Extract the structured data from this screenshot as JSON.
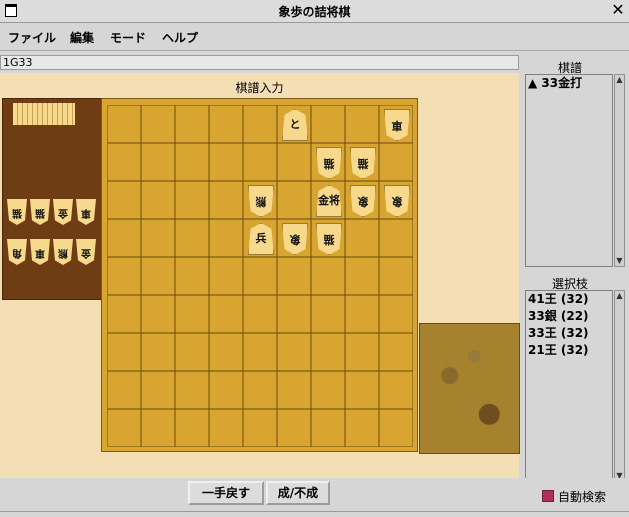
{
  "window": {
    "title": "象歩の詰将棋",
    "close": "✕"
  },
  "menu": {
    "file": "ファイル",
    "edit": "編集",
    "mode": "モード",
    "help": "ヘルプ"
  },
  "status_text": "1G33",
  "board": {
    "label": "棋譜入力",
    "pieces": [
      {
        "col": 5,
        "row": 0,
        "char": "と",
        "side": "sente"
      },
      {
        "col": 8,
        "row": 0,
        "char": "車",
        "side": "gote"
      },
      {
        "col": 6,
        "row": 1,
        "char": "猫",
        "side": "gote"
      },
      {
        "col": 7,
        "row": 1,
        "char": "猫",
        "side": "gote"
      },
      {
        "col": 4,
        "row": 2,
        "char": "熊",
        "side": "gote"
      },
      {
        "col": 6,
        "row": 2,
        "char": "金将",
        "side": "sente"
      },
      {
        "col": 7,
        "row": 2,
        "char": "象",
        "side": "gote"
      },
      {
        "col": 8,
        "row": 2,
        "char": "象",
        "side": "gote"
      },
      {
        "col": 4,
        "row": 3,
        "char": "兵",
        "side": "sente"
      },
      {
        "col": 5,
        "row": 3,
        "char": "象",
        "side": "gote"
      },
      {
        "col": 6,
        "row": 3,
        "char": "猫",
        "side": "gote"
      }
    ]
  },
  "hand_pieces": [
    {
      "char": "角"
    },
    {
      "char": "車"
    },
    {
      "char": "熊"
    },
    {
      "char": "金"
    },
    {
      "char": "猫"
    },
    {
      "char": "猫"
    },
    {
      "char": "金"
    },
    {
      "char": "車"
    }
  ],
  "kifu": {
    "title": "棋譜",
    "moves": [
      "▲ 33金打"
    ]
  },
  "candidates": {
    "title": "選択枝",
    "items": [
      "41王 (32)",
      "33銀 (22)",
      "33王 (32)",
      "21王 (32)"
    ]
  },
  "buttons": {
    "undo": "一手戻す",
    "promote": "成/不成"
  },
  "auto_search": {
    "label": "自動検索",
    "checked": true,
    "color": "#b0305a"
  }
}
